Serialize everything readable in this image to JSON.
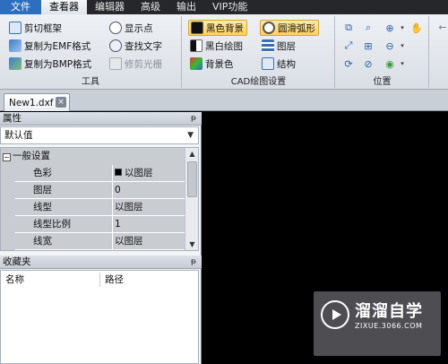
{
  "menubar": {
    "tabs": [
      "文件",
      "查看器",
      "编辑器",
      "高级",
      "输出",
      "VIP功能"
    ]
  },
  "ribbon": {
    "tools": {
      "title": "工具",
      "clip_frame": "剪切框架",
      "copy_emf": "复制为EMF格式",
      "copy_bmp": "复制为BMP格式",
      "show_points": "显示点",
      "find_text": "查找文字",
      "trim_raster": "修剪光栅"
    },
    "cad_settings": {
      "title": "CAD绘图设置",
      "black_bg": "黑色背景",
      "bw_drawing": "黑白绘图",
      "bg_color": "背景色",
      "smooth_arc": "圆滑弧形",
      "layers": "图层",
      "structure": "结构"
    },
    "position": {
      "title": "位置"
    }
  },
  "document": {
    "tab_name": "New1.dxf",
    "close_glyph": "×"
  },
  "properties": {
    "title": "属性",
    "pin_glyph": "ᵽ",
    "select_value": "默认值",
    "group_header": "一般设置",
    "rows": [
      {
        "name": "色彩",
        "value": "以图层",
        "swatch": "#000000"
      },
      {
        "name": "图层",
        "value": "0"
      },
      {
        "name": "线型",
        "value": "以图层"
      },
      {
        "name": "线型比例",
        "value": "1"
      },
      {
        "name": "线宽",
        "value": "以图层"
      }
    ]
  },
  "favorites": {
    "title": "收藏夹",
    "columns": [
      "名称",
      "路径"
    ]
  },
  "watermark": {
    "brand": "溜溜自学",
    "url": "ZIXUE.3066.COM"
  },
  "colors": {
    "accent_file": "#2d6fbd",
    "highlight": "#ffd25e",
    "canvas": "#000000"
  }
}
